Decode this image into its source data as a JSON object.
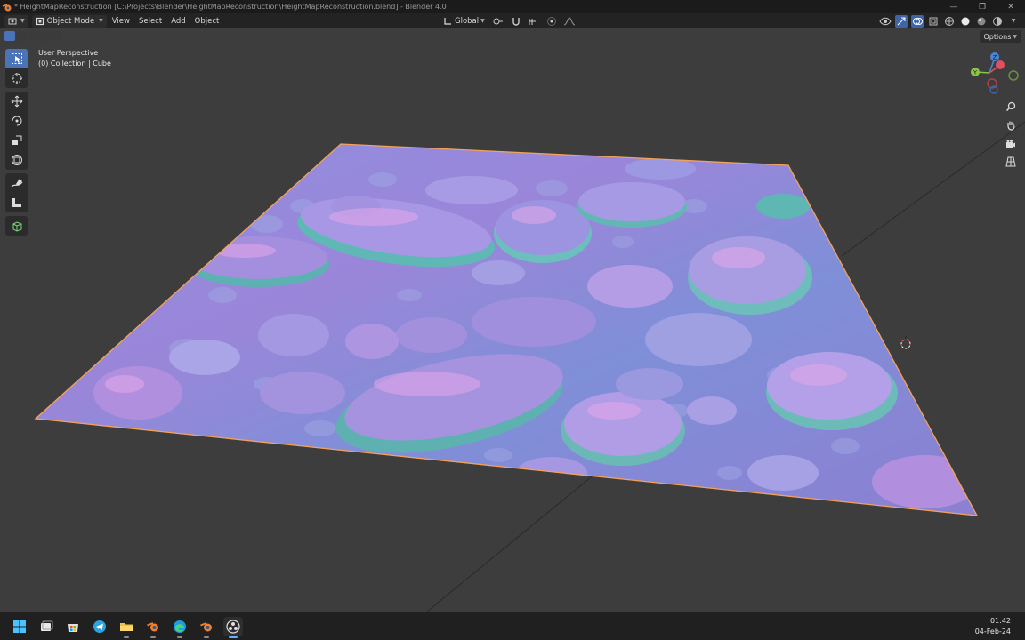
{
  "window": {
    "title": "* HeightMapReconstruction [C:\\Projects\\Blender\\HeightMapReconstruction\\HeightMapReconstruction.blend] - Blender 4.0",
    "controls": [
      "—",
      "❐",
      "✕"
    ]
  },
  "header": {
    "mode": "Object Mode",
    "menus": [
      "View",
      "Select",
      "Add",
      "Object"
    ],
    "transform_orientation": "Global"
  },
  "subheader": {
    "options_label": "Options"
  },
  "viewport": {
    "perspective_label": "User Perspective",
    "collection_label": "(0) Collection | Cube",
    "colors": {
      "background": "#3d3d3d",
      "selection_outline": "#f3a25a",
      "plane_base": "#8e86d6",
      "active_tool": "#4a73b8"
    },
    "gizmo": {
      "x_label": "",
      "y_label": "Y",
      "z_label": "Z"
    }
  },
  "toolbar": {
    "tools": [
      "select-box-icon",
      "cursor-icon",
      "move-icon",
      "rotate-icon",
      "scale-icon",
      "transform-icon",
      "annotate-icon",
      "measure-icon",
      "add-cube-icon"
    ]
  },
  "taskbar": {
    "apps": [
      "windows-start-icon",
      "task-view-icon",
      "store-icon",
      "telegram-icon",
      "file-explorer-icon",
      "blender-icon",
      "edge-icon",
      "blender-icon",
      "obs-icon"
    ],
    "time": "01:42",
    "date": "04-Feb-24"
  }
}
